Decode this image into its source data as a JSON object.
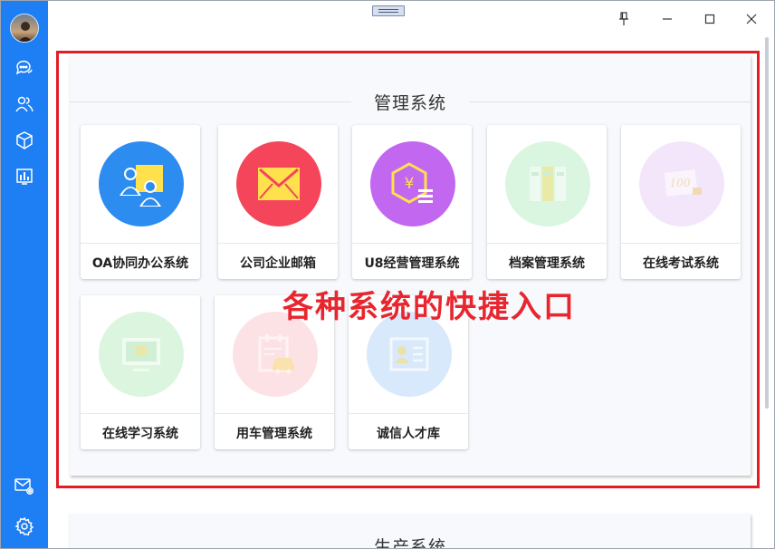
{
  "sidebar": {
    "items": [
      {
        "name": "chat",
        "icon": "chat-bubbles-icon"
      },
      {
        "name": "contacts",
        "icon": "people-icon"
      },
      {
        "name": "apps",
        "icon": "cube-icon"
      },
      {
        "name": "reports",
        "icon": "bar-chart-icon"
      }
    ],
    "bottom_items": [
      {
        "name": "mail-settings",
        "icon": "mail-gear-icon"
      },
      {
        "name": "settings",
        "icon": "gear-icon"
      }
    ]
  },
  "window_controls": [
    "pin-icon",
    "minimize-icon",
    "maximize-icon",
    "close-icon"
  ],
  "section1": {
    "title": "管理系统",
    "cards": [
      {
        "label": "OA协同办公系统",
        "icon": "people-board-icon",
        "color": "#2d8cf0",
        "faded": false
      },
      {
        "label": "公司企业邮箱",
        "icon": "envelope-icon",
        "color": "#f5455a",
        "faded": false
      },
      {
        "label": "U8经营管理系统",
        "icon": "yen-hexagon-icon",
        "color": "#c267f0",
        "faded": false
      },
      {
        "label": "档案管理系统",
        "icon": "file-cabinet-icon",
        "color": "#daf5e0",
        "faded": true
      },
      {
        "label": "在线考试系统",
        "icon": "exam-paper-icon",
        "color": "#f3e6fb",
        "faded": true
      },
      {
        "label": "在线学习系统",
        "icon": "monitor-book-icon",
        "color": "#dcf5df",
        "faded": true
      },
      {
        "label": "用车管理系统",
        "icon": "car-clipboard-icon",
        "color": "#fde2e5",
        "faded": true
      },
      {
        "label": "诚信人才库",
        "icon": "id-card-icon",
        "color": "#d8e9fb",
        "faded": true
      }
    ]
  },
  "overlay": {
    "text": "各种系统的快捷入口",
    "color": "#e8262f"
  },
  "section2": {
    "title": "生产系统"
  }
}
